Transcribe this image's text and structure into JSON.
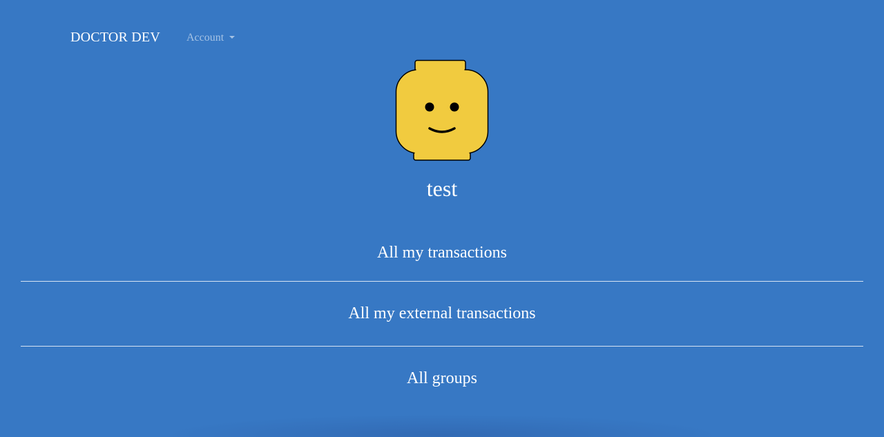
{
  "navbar": {
    "brand": "DOCTOR DEV",
    "account_label": "Account"
  },
  "profile": {
    "username": "test",
    "avatar_icon": "lego-head-icon"
  },
  "menu": {
    "items": [
      {
        "label": "All my transactions"
      },
      {
        "label": "All my external transactions"
      },
      {
        "label": "All groups"
      }
    ]
  },
  "colors": {
    "background": "#3778c4",
    "avatar_yellow": "#f1cb3f",
    "text": "#ffffff"
  }
}
